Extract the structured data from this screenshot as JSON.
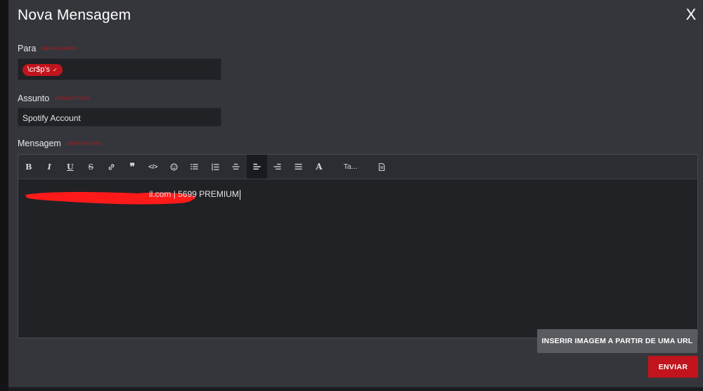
{
  "modal": {
    "title": "Nova Mensagem",
    "close_label": "X"
  },
  "fields": {
    "to": {
      "label": "Para",
      "required": "OBRIGATÓRIO",
      "tags": [
        "\\cr$p's"
      ]
    },
    "subject": {
      "label": "Assunto",
      "required": "OBRIGATÓRIO",
      "value": "Spotify Account"
    },
    "message": {
      "label": "Mensagem",
      "required": "OBRIGATÓRIO",
      "body": "il.com | 5699    PREMIUM"
    }
  },
  "toolbar": {
    "buttons": [
      {
        "icon": "bold-icon",
        "label": "B"
      },
      {
        "icon": "italic-icon",
        "label": "I"
      },
      {
        "icon": "underline-icon",
        "label": "U"
      },
      {
        "icon": "strikethrough-icon",
        "label": "S"
      },
      {
        "icon": "link-icon"
      },
      {
        "icon": "quote-icon"
      },
      {
        "icon": "code-icon"
      },
      {
        "icon": "emoji-icon"
      },
      {
        "icon": "bullet-list-icon"
      },
      {
        "icon": "numbered-list-icon"
      },
      {
        "icon": "align-center-icon"
      },
      {
        "icon": "align-left-icon",
        "active": true
      },
      {
        "icon": "align-right-icon"
      },
      {
        "icon": "justify-icon"
      },
      {
        "icon": "font-color-icon",
        "label": "A"
      },
      {
        "icon": "font-size-dropdown",
        "label": "Ta..."
      },
      {
        "icon": "source-document-icon"
      }
    ]
  },
  "actions": {
    "insert_image": "INSERIR IMAGEM A PARTIR DE UMA URL",
    "send": "ENVIAR"
  },
  "colors": {
    "accent": "#c1141c",
    "modal_bg": "#35363b",
    "input_bg": "#212226"
  }
}
